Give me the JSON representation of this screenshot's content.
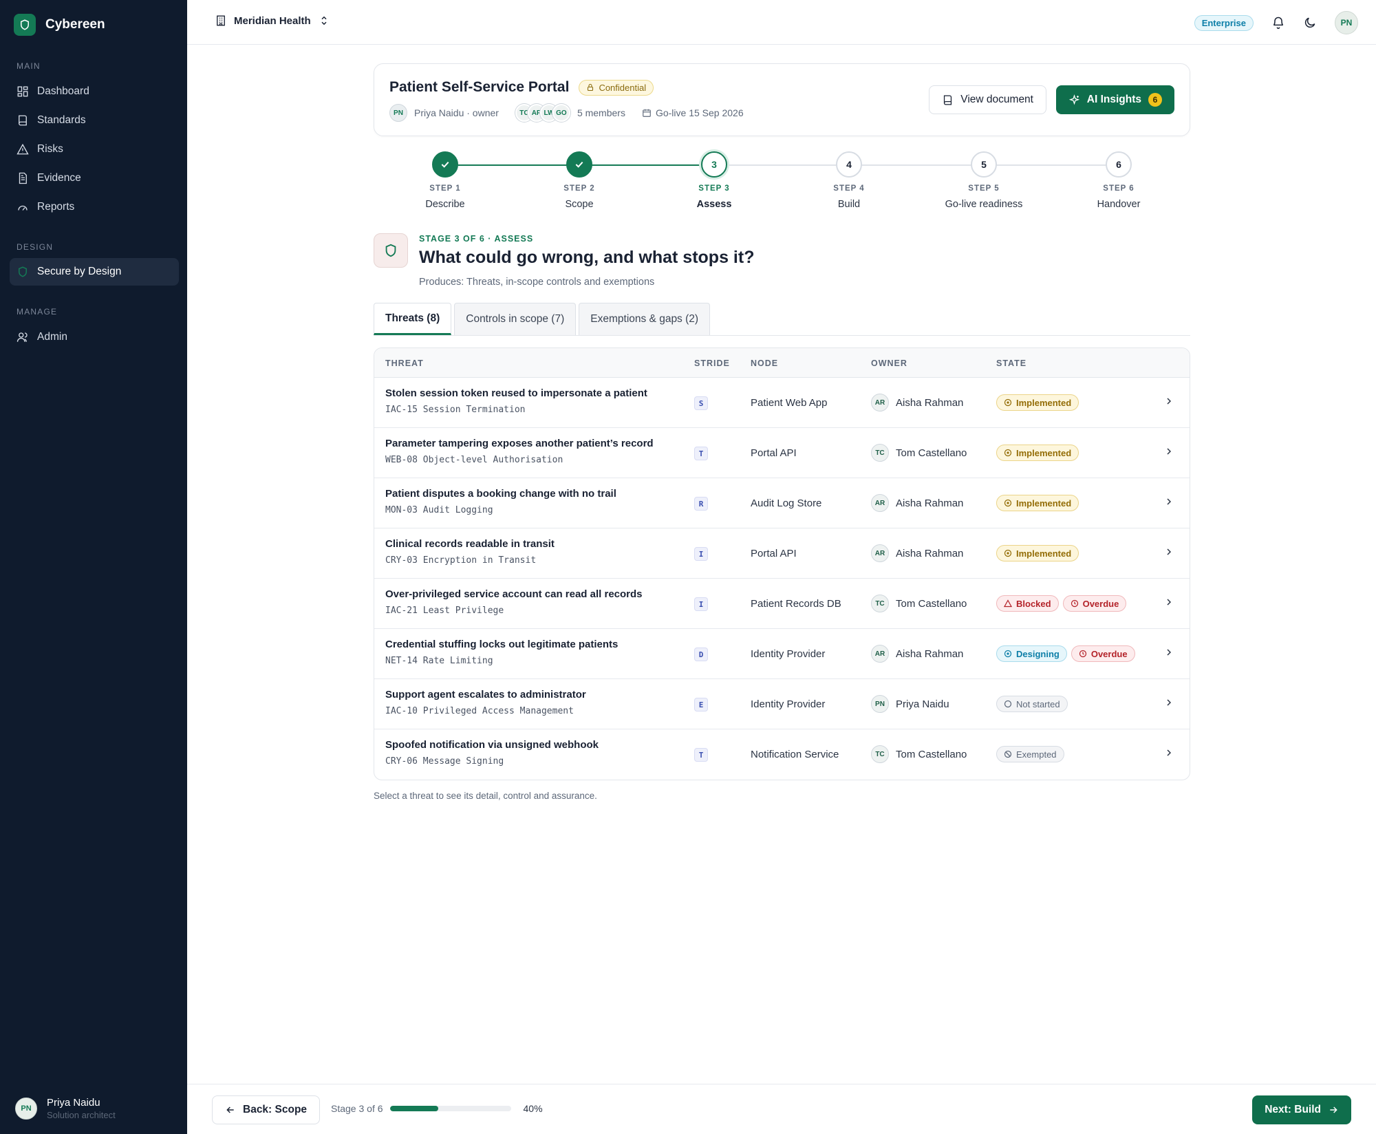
{
  "brand": {
    "name": "Cybereen"
  },
  "sidebar": {
    "sections": [
      {
        "label": "MAIN",
        "items": [
          {
            "label": "Dashboard",
            "icon": "dashboard-icon"
          },
          {
            "label": "Standards",
            "icon": "book-icon"
          },
          {
            "label": "Risks",
            "icon": "warning-icon"
          },
          {
            "label": "Evidence",
            "icon": "document-icon"
          },
          {
            "label": "Reports",
            "icon": "gauge-icon"
          }
        ]
      },
      {
        "label": "DESIGN",
        "items": [
          {
            "label": "Secure by Design",
            "icon": "shield-icon",
            "active": true
          }
        ]
      },
      {
        "label": "MANAGE",
        "items": [
          {
            "label": "Admin",
            "icon": "users-icon"
          }
        ]
      }
    ],
    "user": {
      "initials": "PN",
      "name": "Priya Naidu",
      "role": "Solution architect"
    }
  },
  "topbar": {
    "org": "Meridian Health",
    "plan": "Enterprise",
    "avatar": "PN"
  },
  "project": {
    "title": "Patient Self-Service Portal",
    "classification": "Confidential",
    "owner_initials": "PN",
    "owner": "Priya Naidu · owner",
    "member_initials": [
      "TC",
      "AR",
      "LW",
      "GO"
    ],
    "members": "5 members",
    "golive": "Go-live 15 Sep 2026",
    "view_label": "View document",
    "ai_label": "AI Insights",
    "ai_count": "6"
  },
  "steps": [
    {
      "label": "STEP 1",
      "name": "Describe",
      "num": "1",
      "state": "done"
    },
    {
      "label": "STEP 2",
      "name": "Scope",
      "num": "2",
      "state": "done"
    },
    {
      "label": "STEP 3",
      "name": "Assess",
      "num": "3",
      "state": "current"
    },
    {
      "label": "STEP 4",
      "name": "Build",
      "num": "4",
      "state": "todo"
    },
    {
      "label": "STEP 5",
      "name": "Go-live readiness",
      "num": "5",
      "state": "todo"
    },
    {
      "label": "STEP 6",
      "name": "Handover",
      "num": "6",
      "state": "todo"
    }
  ],
  "stage": {
    "kicker": "STAGE 3 OF 6 · ASSESS",
    "title": "What could go wrong, and what stops it?",
    "subtitle": "Produces: Threats, in-scope controls and exemptions"
  },
  "tabs": [
    {
      "label": "Threats (8)",
      "active": true
    },
    {
      "label": "Controls in scope (7)"
    },
    {
      "label": "Exemptions & gaps (2)"
    }
  ],
  "table": {
    "headers": {
      "threat": "THREAT",
      "stride": "STRIDE",
      "node": "NODE",
      "owner": "OWNER",
      "state": "STATE"
    },
    "rows": [
      {
        "title": "Stolen session token reused to impersonate a patient",
        "control": "IAC-15 Session Termination",
        "stride": "S",
        "node": "Patient Web App",
        "owner_initials": "AR",
        "owner": "Aisha Rahman",
        "states": [
          {
            "label": "Implemented",
            "kind": "impl"
          }
        ]
      },
      {
        "title": "Parameter tampering exposes another patient’s record",
        "control": "WEB-08 Object-level Authorisation",
        "stride": "T",
        "node": "Portal API",
        "owner_initials": "TC",
        "owner": "Tom Castellano",
        "states": [
          {
            "label": "Implemented",
            "kind": "impl"
          }
        ]
      },
      {
        "title": "Patient disputes a booking change with no trail",
        "control": "MON-03 Audit Logging",
        "stride": "R",
        "node": "Audit Log Store",
        "owner_initials": "AR",
        "owner": "Aisha Rahman",
        "states": [
          {
            "label": "Implemented",
            "kind": "impl"
          }
        ]
      },
      {
        "title": "Clinical records readable in transit",
        "control": "CRY-03 Encryption in Transit",
        "stride": "I",
        "node": "Portal API",
        "owner_initials": "AR",
        "owner": "Aisha Rahman",
        "states": [
          {
            "label": "Implemented",
            "kind": "impl"
          }
        ]
      },
      {
        "title": "Over-privileged service account can read all records",
        "control": "IAC-21 Least Privilege",
        "stride": "I",
        "node": "Patient Records DB",
        "owner_initials": "TC",
        "owner": "Tom Castellano",
        "states": [
          {
            "label": "Blocked",
            "kind": "block"
          },
          {
            "label": "Overdue",
            "kind": "over"
          }
        ]
      },
      {
        "title": "Credential stuffing locks out legitimate patients",
        "control": "NET-14 Rate Limiting",
        "stride": "D",
        "node": "Identity Provider",
        "owner_initials": "AR",
        "owner": "Aisha Rahman",
        "states": [
          {
            "label": "Designing",
            "kind": "design"
          },
          {
            "label": "Overdue",
            "kind": "over"
          }
        ]
      },
      {
        "title": "Support agent escalates to administrator",
        "control": "IAC-10 Privileged Access Management",
        "stride": "E",
        "node": "Identity Provider",
        "owner_initials": "PN",
        "owner": "Priya Naidu",
        "states": [
          {
            "label": "Not started",
            "kind": "ns"
          }
        ]
      },
      {
        "title": "Spoofed notification via unsigned webhook",
        "control": "CRY-06 Message Signing",
        "stride": "T",
        "node": "Notification Service",
        "owner_initials": "TC",
        "owner": "Tom Castellano",
        "states": [
          {
            "label": "Exempted",
            "kind": "ex"
          }
        ]
      }
    ],
    "hint": "Select a threat to see its detail, control and assurance."
  },
  "footer": {
    "back_label": "Back: Scope",
    "stage_text": "Stage 3 of 6",
    "progress": 40,
    "progress_label": "40%",
    "next_label": "Next: Build"
  }
}
